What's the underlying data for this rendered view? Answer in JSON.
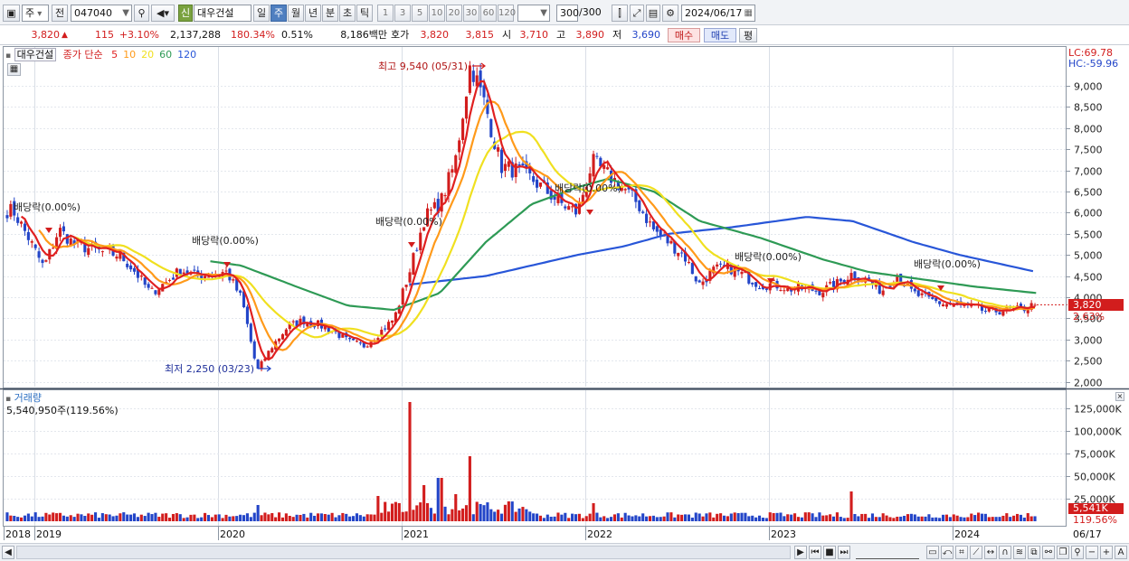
{
  "toolbar": {
    "market": "주",
    "prev_label": "전",
    "code": "047040",
    "credit_badge": "신",
    "name": "대우건설",
    "periods": [
      "일",
      "주",
      "월",
      "년",
      "분",
      "초",
      "틱"
    ],
    "active_period": "주",
    "intervals": [
      "1",
      "3",
      "5",
      "10",
      "20",
      "30",
      "60",
      "120"
    ],
    "count": "300",
    "count_total": "/300",
    "date": "2024/06/17"
  },
  "quote": {
    "price": "3,820",
    "arrow": "▲",
    "change": "115",
    "change_pct": "+3.10%",
    "volume": "2,137,288",
    "volume_ratio": "180.34%",
    "turnover": "0.51%",
    "amount": "8,186백만",
    "hoga_label": "호가",
    "ask": "3,820",
    "bid": "3,815",
    "open_label": "시",
    "open": "3,710",
    "high_label": "고",
    "high": "3,890",
    "low_label": "저",
    "low": "3,690",
    "buy_label": "매수",
    "sell_label": "매도",
    "eval_label": "평"
  },
  "legend": {
    "name": "대우건설",
    "ma_label": "종가 단순",
    "ma_periods": [
      "5",
      "10",
      "20",
      "60",
      "120"
    ],
    "ma_colors": [
      "#e02020",
      "#ff9a1a",
      "#f0e020",
      "#2e9a55",
      "#2856d8"
    ]
  },
  "price_axis": {
    "ticks": [
      "9,000",
      "8,500",
      "8,000",
      "7,500",
      "7,000",
      "6,500",
      "6,000",
      "5,500",
      "5,000",
      "4,500",
      "4,000",
      "3,500",
      "3,000",
      "2,500",
      "2,000"
    ],
    "lc": "LC:69.78",
    "hc": "HC:-59.96",
    "current": "3,820",
    "current_pct": "2.63%"
  },
  "annotations": {
    "high": "최고 9,540 (05/31)",
    "low": "최저 2,250 (03/23)",
    "dividends": [
      "배당락(0.00%)",
      "배당락(0.00%)",
      "배당락(0.00%)",
      "배당락(0.00%)",
      "배당락(0.00%)",
      "배당락(0.00%)",
      "배당락(0.00%)"
    ]
  },
  "volume_panel": {
    "title": "거래량",
    "current": "5,540,950주(119.56%)",
    "ticks": [
      "125,000K",
      "100,000K",
      "75,000K",
      "50,000K",
      "25,000K"
    ],
    "badge_value": "5,541K",
    "badge_pct": "119.56%"
  },
  "time_axis": {
    "years": [
      "2018",
      "2019",
      "2020",
      "2021",
      "2022",
      "2023",
      "2024"
    ],
    "last_label": "06/17"
  },
  "chart_data": {
    "type": "line",
    "title": "대우건설",
    "y_unit": "KRW",
    "ylim": [
      2000,
      9700
    ],
    "x_range": [
      "2018-11",
      "2024-06-17"
    ],
    "close_weekly_sampled": [
      [
        "2018-11",
        6050
      ],
      [
        "2018-12",
        5400
      ],
      [
        "2019-01",
        4700
      ],
      [
        "2019-02",
        5600
      ],
      [
        "2019-03",
        5250
      ],
      [
        "2019-05",
        5050
      ],
      [
        "2019-06",
        5000
      ],
      [
        "2019-07",
        4600
      ],
      [
        "2019-08",
        4100
      ],
      [
        "2019-09",
        4350
      ],
      [
        "2019-10",
        4650
      ],
      [
        "2019-11",
        4500
      ],
      [
        "2019-12",
        4550
      ],
      [
        "2020-01",
        4600
      ],
      [
        "2020-02",
        3950
      ],
      [
        "2020-03",
        2250
      ],
      [
        "2020-04",
        2850
      ],
      [
        "2020-05",
        3300
      ],
      [
        "2020-06",
        3450
      ],
      [
        "2020-07",
        3350
      ],
      [
        "2020-08",
        3200
      ],
      [
        "2020-09",
        2950
      ],
      [
        "2020-10",
        2850
      ],
      [
        "2020-11",
        3150
      ],
      [
        "2020-12",
        3500
      ],
      [
        "2021-01",
        4600
      ],
      [
        "2021-02",
        5900
      ],
      [
        "2021-03",
        6200
      ],
      [
        "2021-04",
        7200
      ],
      [
        "2021-05",
        9540
      ],
      [
        "2021-06",
        8500
      ],
      [
        "2021-07",
        7100
      ],
      [
        "2021-08",
        7000
      ],
      [
        "2021-09",
        6800
      ],
      [
        "2021-10",
        6500
      ],
      [
        "2021-11",
        6200
      ],
      [
        "2021-12",
        6000
      ],
      [
        "2022-01",
        7200
      ],
      [
        "2022-02",
        6900
      ],
      [
        "2022-03",
        6600
      ],
      [
        "2022-04",
        6200
      ],
      [
        "2022-05",
        5600
      ],
      [
        "2022-06",
        5300
      ],
      [
        "2022-07",
        5000
      ],
      [
        "2022-08",
        4300
      ],
      [
        "2022-09",
        4650
      ],
      [
        "2022-10",
        4700
      ],
      [
        "2022-11",
        4500
      ],
      [
        "2022-12",
        4300
      ],
      [
        "2023-01",
        4300
      ],
      [
        "2023-02",
        4200
      ],
      [
        "2023-03",
        4200
      ],
      [
        "2023-04",
        4150
      ],
      [
        "2023-05",
        4300
      ],
      [
        "2023-06",
        4550
      ],
      [
        "2023-07",
        4400
      ],
      [
        "2023-08",
        4150
      ],
      [
        "2023-09",
        4550
      ],
      [
        "2023-10",
        4100
      ],
      [
        "2023-11",
        3950
      ],
      [
        "2023-12",
        3850
      ],
      [
        "2024-01",
        3800
      ],
      [
        "2024-02",
        3750
      ],
      [
        "2024-03",
        3650
      ],
      [
        "2024-04",
        3700
      ],
      [
        "2024-05",
        3700
      ],
      [
        "2024-06",
        3820
      ]
    ],
    "series": [
      {
        "name": "5",
        "color": "#e02020"
      },
      {
        "name": "10",
        "color": "#ff9a1a"
      },
      {
        "name": "20",
        "color": "#f0e020"
      },
      {
        "name": "60",
        "color": "#2e9a55"
      },
      {
        "name": "120",
        "color": "#2856d8"
      }
    ],
    "ma120_sampled": [
      [
        "2021-01",
        4300
      ],
      [
        "2021-06",
        4500
      ],
      [
        "2021-12",
        5000
      ],
      [
        "2022-03",
        5200
      ],
      [
        "2022-06",
        5500
      ],
      [
        "2022-10",
        5650
      ],
      [
        "2023-03",
        5900
      ],
      [
        "2023-06",
        5800
      ],
      [
        "2023-10",
        5300
      ],
      [
        "2024-01",
        5000
      ],
      [
        "2024-06",
        4600
      ]
    ],
    "ma60_sampled": [
      [
        "2019-12",
        4850
      ],
      [
        "2020-02",
        4750
      ],
      [
        "2020-06",
        4200
      ],
      [
        "2020-09",
        3800
      ],
      [
        "2020-12",
        3700
      ],
      [
        "2021-03",
        4100
      ],
      [
        "2021-06",
        5300
      ],
      [
        "2021-09",
        6200
      ],
      [
        "2021-12",
        6600
      ],
      [
        "2022-02",
        6800
      ],
      [
        "2022-05",
        6500
      ],
      [
        "2022-08",
        5800
      ],
      [
        "2022-12",
        5400
      ],
      [
        "2023-04",
        4900
      ],
      [
        "2023-07",
        4600
      ],
      [
        "2023-10",
        4450
      ],
      [
        "2024-02",
        4250
      ],
      [
        "2024-06",
        4100
      ]
    ],
    "volume_unit": "K shares",
    "volume_ylim": [
      0,
      135000
    ],
    "volume_spikes_sampled": [
      [
        "2020-03",
        18000
      ],
      [
        "2020-11",
        28000
      ],
      [
        "2021-01",
        132000
      ],
      [
        "2021-02",
        40000
      ],
      [
        "2021-03",
        48000
      ],
      [
        "2021-04",
        30000
      ],
      [
        "2021-05",
        72000
      ],
      [
        "2022-01",
        20000
      ],
      [
        "2023-06",
        33000
      ],
      [
        "2024-06",
        5541
      ]
    ]
  }
}
